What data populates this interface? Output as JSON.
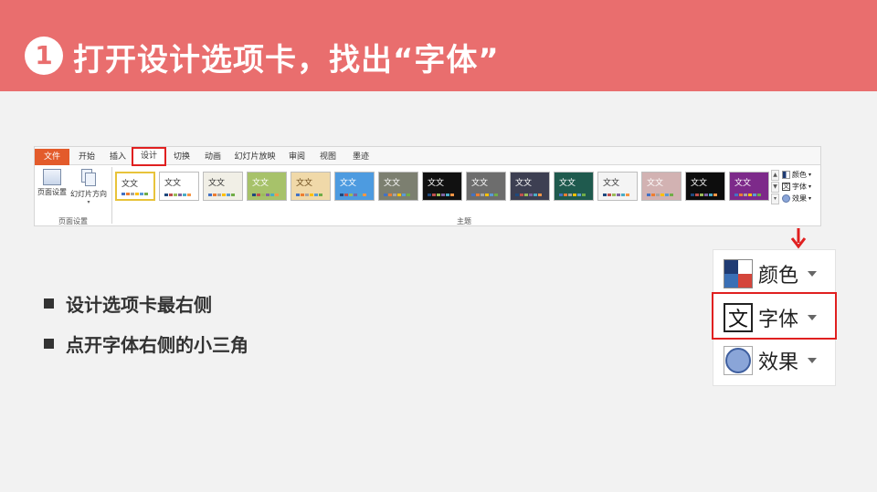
{
  "header": {
    "step_number": "1",
    "title": "打开设计选项卡，找出“字体”",
    "bg_color": "#e96e6e"
  },
  "ribbon": {
    "tabs": [
      {
        "label": "文件",
        "kind": "file"
      },
      {
        "label": "开始"
      },
      {
        "label": "插入"
      },
      {
        "label": "设计",
        "active": true
      },
      {
        "label": "切换"
      },
      {
        "label": "动画"
      },
      {
        "label": "幻灯片放映"
      },
      {
        "label": "审阅"
      },
      {
        "label": "视图"
      },
      {
        "label": "墨迹"
      }
    ],
    "page_setup_group": {
      "label": "页面设置",
      "page_setup_button": "页面设置",
      "orientation_button": "幻灯片方向"
    },
    "themes_group": {
      "label": "主题",
      "themes": [
        {
          "text": "文文",
          "bg": "#ffffff",
          "fg": "#333333",
          "selected": true
        },
        {
          "text": "文文",
          "bg": "#ffffff",
          "fg": "#333333"
        },
        {
          "text": "文文",
          "bg": "#f1efe6",
          "fg": "#333333"
        },
        {
          "text": "文文",
          "bg": "#a7c26a",
          "fg": "#ffffff"
        },
        {
          "text": "文文",
          "bg": "#f0d9a9",
          "fg": "#6a4a1a"
        },
        {
          "text": "文文",
          "bg": "#4d9be0",
          "fg": "#ffffff"
        },
        {
          "text": "文文",
          "bg": "#7c7f70",
          "fg": "#ffffff"
        },
        {
          "text": "文文",
          "bg": "#111111",
          "fg": "#ffffff"
        },
        {
          "text": "文文",
          "bg": "#6d6d6d",
          "fg": "#ffffff"
        },
        {
          "text": "文文",
          "bg": "#3d3f52",
          "fg": "#ffffff"
        },
        {
          "text": "文文",
          "bg": "#1f5a4e",
          "fg": "#ffffff"
        },
        {
          "text": "文文",
          "bg": "#f4f4f4",
          "fg": "#333333"
        },
        {
          "text": "文文",
          "bg": "#d2b2b2",
          "fg": "#ffffff"
        },
        {
          "text": "文文",
          "bg": "#0d0d0d",
          "fg": "#ffffff"
        },
        {
          "text": "文文",
          "bg": "#7d2a8a",
          "fg": "#ffffff"
        }
      ],
      "scroll_up": "▲",
      "scroll_down": "▼",
      "scroll_more": "▾"
    },
    "variant_menu": {
      "colors": "颜色",
      "fonts": "字体",
      "effects": "效果"
    }
  },
  "zoom": {
    "colors": "颜色",
    "fonts": "字体",
    "effects": "效果"
  },
  "bullets": [
    "设计选项卡最右侧",
    "点开字体右侧的小三角"
  ]
}
